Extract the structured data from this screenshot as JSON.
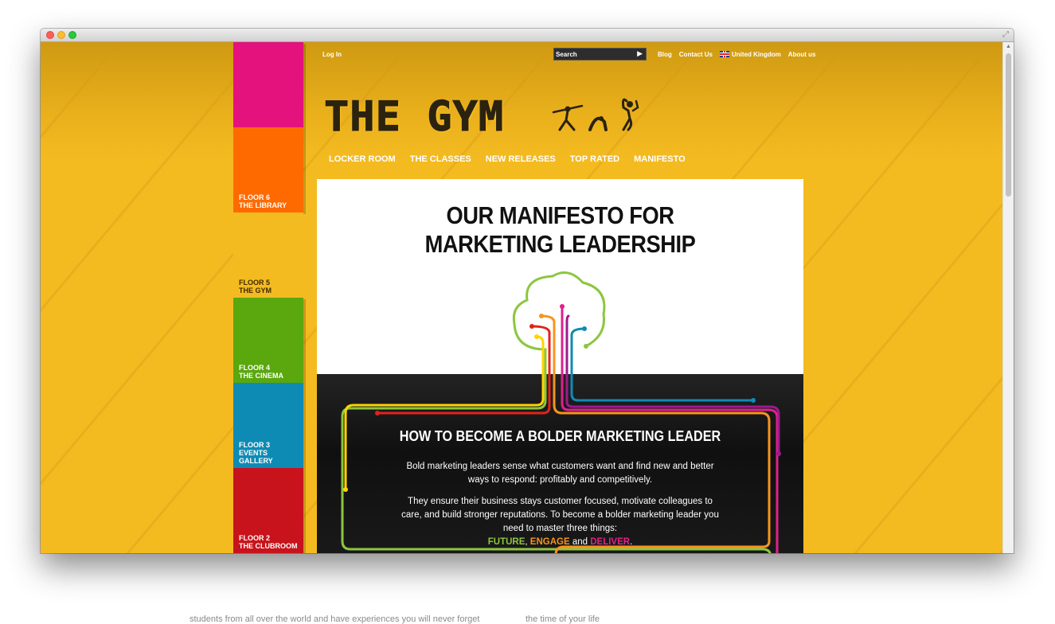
{
  "topbar": {
    "login": "Log In",
    "search_placeholder": "Search",
    "links": [
      "Blog",
      "Contact Us",
      "United Kingdom",
      "About us"
    ]
  },
  "logo": {
    "text": "THE GYM"
  },
  "nav": [
    "LOCKER ROOM",
    "THE CLASSES",
    "NEW RELEASES",
    "TOP RATED",
    "MANIFESTO"
  ],
  "floors": [
    {
      "line1": "FLOOR 6",
      "line2": "THE LIBRARY",
      "color": "#ff6a00"
    },
    {
      "line1": "FLOOR 5",
      "line2": "THE GYM",
      "color": "#f4bb21"
    },
    {
      "line1": "FLOOR 4",
      "line2": "THE CINEMA",
      "color": "#5aa70e"
    },
    {
      "line1": "FLOOR 3",
      "line2": "EVENTS GALLERY",
      "color": "#0e8bb5"
    },
    {
      "line1": "FLOOR 2",
      "line2": "THE CLUBROOM",
      "color": "#c8131c"
    }
  ],
  "floor_top_color": "#e4127d",
  "main": {
    "headline_line1": "OUR MANIFESTO FOR",
    "headline_line2": "MARKETING LEADERSHIP",
    "subhead": "HOW TO BECOME A BOLDER MARKETING LEADER",
    "para1": "Bold marketing leaders sense what customers want and find new and better ways to respond: profitably and competitively.",
    "para2": "They ensure their business stays customer focused, motivate colleagues to care, and build stronger reputations. To become a bolder marketing leader you need to master three things:",
    "word_future": "FUTURE",
    "sep1": ",",
    "word_engage": "ENGAGE",
    "sep2": "and",
    "word_deliver": "DELIVER",
    "end": "."
  },
  "colors": {
    "background": "#f4bb21",
    "green": "#8dc63f",
    "orange": "#f7941d",
    "magenta": "#e0218a",
    "red": "#e2231a",
    "blue": "#0e8bb5",
    "yellow": "#ffd400"
  },
  "below_window": {
    "left_text": "students from all over the world and have experiences you will never forget",
    "right_text": "the time of your life"
  }
}
